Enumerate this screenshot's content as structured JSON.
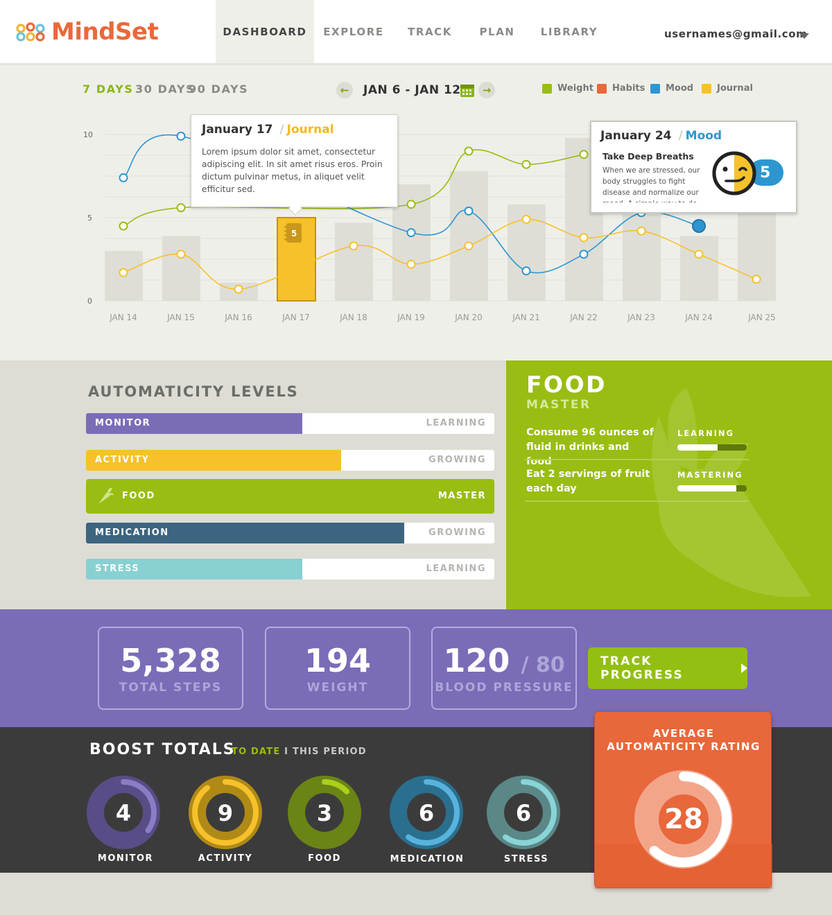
{
  "app": {
    "logo_text": "MindSet",
    "colors": {
      "accent": "#e8693c",
      "green": "#99bd12",
      "purple": "#7b6cb8",
      "blue": "#2d96d0",
      "yellow": "#f6c12a",
      "teal": "#88d0d2",
      "navy": "#3d6580"
    }
  },
  "nav": {
    "items": [
      "DASHBOARD",
      "EXPLORE",
      "TRACK",
      "PLAN",
      "LIBRARY"
    ],
    "active": "DASHBOARD",
    "user_email": "usernames@gmail.com"
  },
  "filters": {
    "ranges": [
      "7 DAYS",
      "30 DAYS",
      "90 DAYS"
    ],
    "selected": "7 DAYS",
    "date_range": "JAN 6 - JAN 12",
    "prev_icon": "arrow-left-icon",
    "next_icon": "arrow-right-icon",
    "calendar_icon": "calendar-icon"
  },
  "legend": [
    {
      "label": "Weight",
      "color": "#99bd12"
    },
    {
      "label": "Habits",
      "color": "#e8673b"
    },
    {
      "label": "Mood",
      "color": "#2d96d0"
    },
    {
      "label": "Journal",
      "color": "#f6c12a"
    }
  ],
  "chart_data": {
    "type": "line",
    "categories": [
      "JAN 14",
      "JAN 15",
      "JAN 16",
      "JAN 17",
      "JAN 18",
      "JAN 19",
      "JAN 20",
      "JAN 21",
      "JAN 22",
      "JAN 23",
      "JAN 24",
      "JAN 25"
    ],
    "ylim": [
      0,
      10
    ],
    "y_ticks": [
      "0",
      "5",
      "10"
    ],
    "bars": [
      3.0,
      3.9,
      1.1,
      5.0,
      4.7,
      7.0,
      7.8,
      5.8,
      9.8,
      5.2,
      3.9,
      7.0
    ],
    "highlight_bar_index": 3,
    "highlight_bar_label": "5",
    "series": [
      {
        "name": "Weight",
        "color": "#99bd12",
        "points": [
          [
            0,
            4.5
          ],
          [
            1,
            5.6
          ],
          [
            5,
            5.8
          ],
          [
            6,
            9.0
          ],
          [
            7,
            8.2
          ],
          [
            8,
            8.8
          ]
        ]
      },
      {
        "name": "Mood",
        "color": "#2d96d0",
        "points": [
          [
            0,
            7.4
          ],
          [
            1,
            9.9
          ],
          [
            5,
            4.1
          ],
          [
            6,
            5.4
          ],
          [
            7,
            1.8
          ],
          [
            8,
            2.8
          ],
          [
            9,
            5.3
          ],
          [
            10,
            4.5
          ]
        ]
      },
      {
        "name": "Journal",
        "color": "#f6c12a",
        "points": [
          [
            0,
            1.7
          ],
          [
            1,
            2.8
          ],
          [
            2,
            0.7
          ],
          [
            4,
            3.3
          ],
          [
            5,
            2.2
          ],
          [
            6,
            3.3
          ],
          [
            7,
            4.9
          ],
          [
            8,
            3.8
          ],
          [
            9,
            4.2
          ],
          [
            10,
            2.8
          ],
          [
            11,
            1.3
          ]
        ]
      }
    ],
    "grid": true
  },
  "tooltips": {
    "journal": {
      "date": "January 17",
      "sep": "/",
      "type": "Journal",
      "body": "Lorem ipsum dolor sit amet, consectetur adipiscing elit. In sit amet risus eros. Proin dictum pulvinar metus, in aliquet velit efficitur sed."
    },
    "mood": {
      "date": "January 24",
      "sep": "/",
      "type": "Mood",
      "title": "Take Deep Breaths",
      "body": "When we are stressed, our body struggles to fight disease and normalize our mood. A simple way to de",
      "score": "5",
      "face_icon": "mood-face-icon"
    }
  },
  "automaticity": {
    "title": "AUTOMATICITY LEVELS",
    "items": [
      {
        "label": "MONITOR",
        "level": "LEARNING",
        "fill": 0.53,
        "color": "#7b6cb8"
      },
      {
        "label": "ACTIVITY",
        "level": "GROWING",
        "fill": 0.625,
        "color": "#f6c12a"
      },
      {
        "label": "FOOD",
        "level": "MASTER",
        "fill": 1.0,
        "color": "#99bd12",
        "icon": "carrot-icon"
      },
      {
        "label": "MEDICATION",
        "level": "GROWING",
        "fill": 0.78,
        "color": "#3d6580"
      },
      {
        "label": "STRESS",
        "level": "LEARNING",
        "fill": 0.53,
        "color": "#88d0d2"
      }
    ]
  },
  "food_panel": {
    "title": "FOOD",
    "subtitle": "MASTER",
    "goals": [
      {
        "text": "Consume 96 ounces of fluid in drinks and food",
        "status": "LEARNING",
        "progress": 0.58
      },
      {
        "text": "Eat 2 servings of fruit each day",
        "status": "MASTERING",
        "progress": 0.85
      }
    ],
    "background_icon": "carrot-icon"
  },
  "stats": [
    {
      "value": "5,328",
      "suffix": "",
      "label": "TOTAL STEPS"
    },
    {
      "value": "194",
      "suffix": "",
      "label": "WEIGHT"
    },
    {
      "value": "120",
      "suffix": "/ 80",
      "label": "BLOOD PRESSURE"
    }
  ],
  "track_button": {
    "label": "TRACK PROGRESS",
    "icon": "play-arrow-icon"
  },
  "boost": {
    "title": "BOOST TOTALS",
    "filter_active": "TO DATE",
    "filter_sep": "I",
    "filter_inactive": "THIS PERIOD",
    "items": [
      {
        "label": "MONITOR",
        "value": "4",
        "progress": 0.35,
        "outer": "#5a4c86",
        "arc": "#8b7cc6"
      },
      {
        "label": "ACTIVITY",
        "value": "9",
        "progress": 0.9,
        "outer": "#b08a16",
        "arc": "#f6c12a"
      },
      {
        "label": "FOOD",
        "value": "3",
        "progress": 0.13,
        "outer": "#6b8416",
        "arc": "#a9cf1c"
      },
      {
        "label": "MEDICATION",
        "value": "6",
        "progress": 0.6,
        "outer": "#2b6f8f",
        "arc": "#58b3dc"
      },
      {
        "label": "STRESS",
        "value": "6",
        "progress": 0.6,
        "outer": "#5b8787",
        "arc": "#88d4d6"
      }
    ]
  },
  "average_rating": {
    "title_line1": "AVERAGE",
    "title_line2": "AUTOMATICITY RATING",
    "value": "28",
    "progress": 0.62
  }
}
